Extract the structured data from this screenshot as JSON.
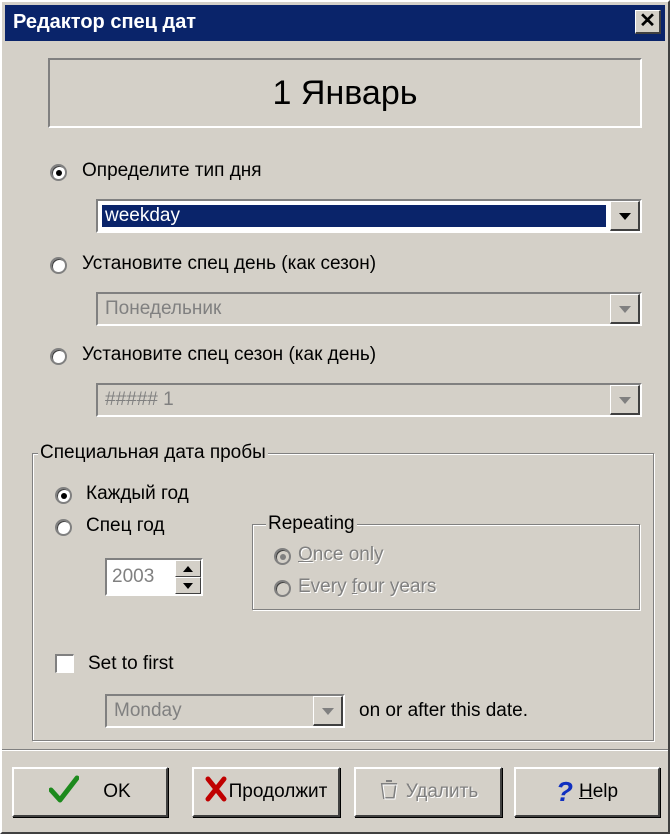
{
  "window": {
    "title": "Редактор спец дат",
    "close_glyph": "✕"
  },
  "header": {
    "date": "1 Январь"
  },
  "day_type": {
    "radio1_label": "Определите тип дня",
    "combo1_value": "weekday",
    "radio2_label": "Установите спец день (как сезон)",
    "combo2_value": "Понедельник",
    "radio3_label": "Установите спец сезон (как день)",
    "combo3_value": "##### 1"
  },
  "group": {
    "title": "Специальная дата пробы",
    "every_year_label": "Каждый год",
    "special_year_label": "Спец год",
    "year_value": "2003",
    "repeating_title": "Repeating",
    "once_only_first": "O",
    "once_only_rest": "nce only",
    "every_four_a": "Every ",
    "every_four_u": "f",
    "every_four_b": "our years",
    "set_first_label": "Set to first",
    "weekday_value": "Monday",
    "after_date_label": "on or after this date."
  },
  "buttons": {
    "ok": "OK",
    "continue": "Продолжит",
    "delete": "Удалить",
    "help_u": "H",
    "help_rest": "elp"
  },
  "icons": {
    "ok": "checkmark-icon",
    "continue": "x-mark-icon",
    "delete": "trash-icon",
    "help": "question-mark-icon"
  },
  "colors": {
    "titlebar": "#0a246a",
    "face": "#d4d0c8",
    "ok_check": "#1d8a1d",
    "cancel_x": "#c00000",
    "help": "#1030c0"
  }
}
